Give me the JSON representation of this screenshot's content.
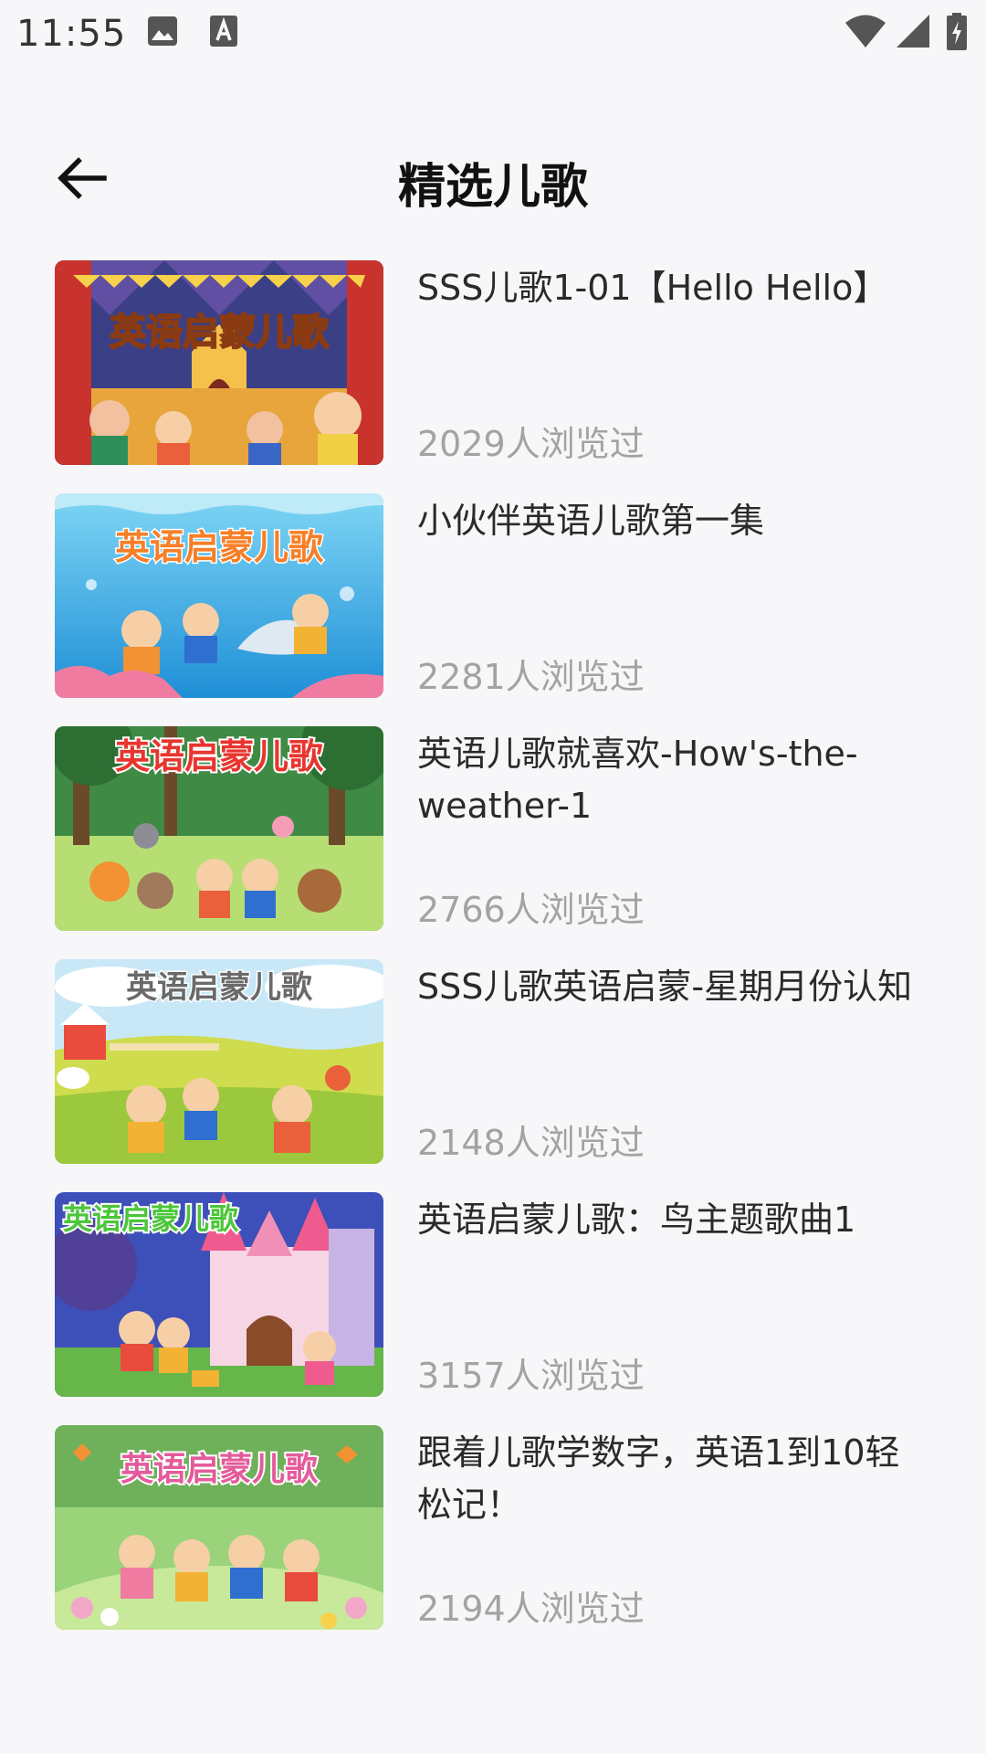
{
  "status_bar": {
    "time": "11:55",
    "icons": [
      "gallery-icon",
      "font-a-icon",
      "wifi-icon",
      "signal-icon",
      "battery-charging-icon"
    ]
  },
  "header": {
    "title": "精选儿歌",
    "back_icon": "arrow-left-icon"
  },
  "songs": [
    {
      "title": "SSS儿歌1-01【Hello Hello】",
      "views": "2029人浏览过",
      "thumb_caption": "英语启蒙儿歌",
      "thumb_theme": "circus-stage",
      "thumb_colors": [
        "#3a3a7a",
        "#e94b3c",
        "#f7b733"
      ]
    },
    {
      "title": "小伙伴英语儿歌第一集",
      "views": "2281人浏览过",
      "thumb_caption": "英语启蒙儿歌",
      "thumb_theme": "underwater-dolphin",
      "thumb_colors": [
        "#2aa6e8",
        "#7fd6f5",
        "#f77f27"
      ]
    },
    {
      "title": "英语儿歌就喜欢-How's-the-weather-1",
      "views": "2766人浏览过",
      "thumb_caption": "英语启蒙儿歌",
      "thumb_theme": "forest-animals",
      "thumb_colors": [
        "#2f7a3b",
        "#a8d86a",
        "#e8352f"
      ]
    },
    {
      "title": "SSS儿歌英语启蒙-星期月份认知",
      "views": "2148人浏览过",
      "thumb_caption": "英语启蒙儿歌",
      "thumb_theme": "farm",
      "thumb_colors": [
        "#bfe4f5",
        "#c9d94a",
        "#6a6a6a"
      ]
    },
    {
      "title": "英语启蒙儿歌：鸟主题歌曲1",
      "views": "3157人浏览过",
      "thumb_caption": "英语启蒙儿歌",
      "thumb_theme": "castle",
      "thumb_colors": [
        "#3d4fb8",
        "#f7c5d9",
        "#4cc63a"
      ]
    },
    {
      "title": "跟着儿歌学数字，英语1到10轻松记！",
      "views": "2194人浏览过",
      "thumb_caption": "英语启蒙儿歌",
      "thumb_theme": "flower-meadow",
      "thumb_colors": [
        "#8fcf6a",
        "#f3a7c8",
        "#e45b9b"
      ]
    }
  ]
}
